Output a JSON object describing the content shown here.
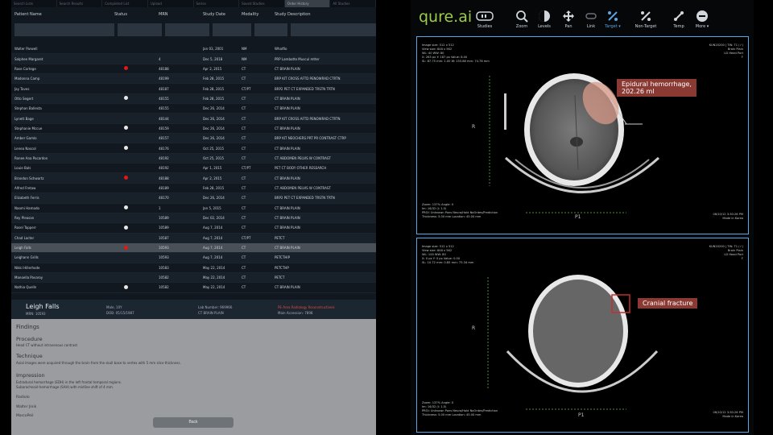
{
  "worklist": {
    "top_tabs": [
      "Search Lists",
      "Search Results",
      "Completed List",
      "Upload",
      "Series",
      "Saved Studies",
      "Order History",
      "All Studies"
    ],
    "active_tab": 6,
    "columns": [
      "Patient Name",
      "Status",
      "MRN",
      "Study Date",
      "Modality",
      "Study Description"
    ],
    "rows": [
      {
        "name": "Walter Parwell",
        "status": "",
        "mrn": "",
        "date": "Jan 03, 2001",
        "mod": "NM",
        "desc": "Whatfio"
      },
      {
        "name": "Salphee Margaret",
        "status": "",
        "mrn": "4",
        "date": "Dec 5, 2018",
        "mod": "NM",
        "desc": "PRP Lambotte Muscul mtter"
      },
      {
        "name": "Rose Cortege",
        "status": "red",
        "mrn": "48188",
        "date": "Apr 2, 2015",
        "mod": "CT",
        "desc": "CT BRAIN PLAIN"
      },
      {
        "name": "Madonna Camp",
        "status": "",
        "mrn": "48199",
        "date": "Feb 28, 2015",
        "mod": "CT",
        "desc": "BRP KIT CROSS AFTD PENOWRAD CTRTN"
      },
      {
        "name": "Jay Taves",
        "status": "",
        "mrn": "48187",
        "date": "Feb 28, 2015",
        "mod": "CT/PT",
        "desc": "BRP2 PET CT EXPANDED TRSTN TRTN"
      },
      {
        "name": "Otto Segert",
        "status": "white",
        "mrn": "48155",
        "date": "Feb 28, 2015",
        "mod": "CT",
        "desc": "CT BRAIN PLAIN"
      },
      {
        "name": "Stephan Ballesta",
        "status": "",
        "mrn": "48155",
        "date": "Dec 26, 2014",
        "mod": "CT",
        "desc": "CT BRAIN PLAIN"
      },
      {
        "name": "Lynett Bage",
        "status": "",
        "mrn": "48144",
        "date": "Dec 26, 2014",
        "mod": "CT",
        "desc": "BRP KIT CROSS AFTD PENOWRAD CTRTN"
      },
      {
        "name": "Stephanie Mccue",
        "status": "white",
        "mrn": "48159",
        "date": "Dec 26, 2014",
        "mod": "CT",
        "desc": "CT BRAIN PLAIN"
      },
      {
        "name": "Amber Gamlo",
        "status": "",
        "mrn": "48157",
        "date": "Dec 26, 2014",
        "mod": "CT",
        "desc": "BRP KIT NEOCHERS PRT PR CONTRAST CTRP"
      },
      {
        "name": "Lenea Nascol",
        "status": "white",
        "mrn": "48176",
        "date": "Oct 25, 2015",
        "mod": "CT",
        "desc": "CT BRAIN PLAIN"
      },
      {
        "name": "Ronee Ana Pocardon",
        "status": "",
        "mrn": "48192",
        "date": "Oct 25, 2015",
        "mod": "CT",
        "desc": "CT ABDOMEN PELVIS W CONTRAST"
      },
      {
        "name": "Louie Bals",
        "status": "",
        "mrn": "48192",
        "date": "Apr 1, 2015",
        "mod": "CT/PT",
        "desc": "PET CT BODY OTHER RESEARCH"
      },
      {
        "name": "Brandon Schwartz",
        "status": "red",
        "mrn": "48188",
        "date": "Apr 2, 2015",
        "mod": "CT",
        "desc": "CT BRAIN PLAIN"
      },
      {
        "name": "Alfred Fretaw",
        "status": "",
        "mrn": "48189",
        "date": "Feb 28, 2015",
        "mod": "CT",
        "desc": "CT ABDOMEN PELVIS W CONTRAST"
      },
      {
        "name": "Elizabeth Ferris",
        "status": "",
        "mrn": "48170",
        "date": "Dec 26, 2014",
        "mod": "CT",
        "desc": "BRP2 PET CT EXPANDED TRSTN TRTN"
      },
      {
        "name": "Naomi Hamado",
        "status": "white",
        "mrn": "1",
        "date": "Jan 5, 2015",
        "mod": "CT",
        "desc": "CT BRAIN PLAIN"
      },
      {
        "name": "Rey Pleasan",
        "status": "",
        "mrn": "10589",
        "date": "Dec 02, 2014",
        "mod": "CT",
        "desc": "CT BRAIN PLAIN"
      },
      {
        "name": "Rosel Tapperr",
        "status": "white",
        "mrn": "10589",
        "date": "Aug 7, 2014",
        "mod": "CT",
        "desc": "CT BRAIN PLAIN"
      },
      {
        "name": "Chad Lacter",
        "status": "",
        "mrn": "10587",
        "date": "Aug 7, 2014",
        "mod": "CT/PT",
        "desc": "PETCT"
      },
      {
        "name": "Leigh Falls",
        "status": "red",
        "mrn": "10593",
        "date": "Aug 7, 2014",
        "mod": "CT",
        "desc": "CT BRAIN PLAIN"
      },
      {
        "name": "Leighann Grills",
        "status": "",
        "mrn": "10593",
        "date": "Aug 7, 2014",
        "mod": "CT",
        "desc": "PETCTHIP"
      },
      {
        "name": "Nikki Hillerhode",
        "status": "",
        "mrn": "10583",
        "date": "May 22, 2014",
        "mod": "CT",
        "desc": "PETCTHP"
      },
      {
        "name": "Manoella Pavaroy",
        "status": "",
        "mrn": "10582",
        "date": "May 22, 2014",
        "mod": "CT",
        "desc": "PETCT"
      },
      {
        "name": "Nathia Quelln",
        "status": "white",
        "mrn": "10582",
        "date": "May 22, 2014",
        "mod": "CT",
        "desc": "CT BRAIN PLAIN"
      }
    ],
    "selected_row": 20
  },
  "detail": {
    "name": "Leigh Falls",
    "mrn": "MRN: 10593",
    "sex": "Male, 10Y",
    "dob": "DOB: 05/15/1987",
    "accession": "Lab Number: 969966",
    "study": "CT BRAIN PLAIN",
    "urgent": "PE Area Radiology Reconstructiveis",
    "institution": "Main Accession: 7898"
  },
  "report": {
    "findings": "Findings",
    "procedure_h": "Procedure",
    "procedure": "Head CT without intravenous contrast",
    "technique_h": "Technique",
    "technique": "Axial images were acquired through the brain from the skull base to vertex with 5 mm slice thickness.",
    "impression_h": "Impression",
    "impression1": "Extradural hemorrhage (EDH) in the left frontal temporal regions.",
    "impression2": "Subarachnoid hemorrhage (SAH) with midline shift of 4 mm.",
    "footer1": "Radiolo",
    "footer2": "Walter Jinik",
    "footer3": "MarcoPeil",
    "back_label": "Back"
  },
  "viewer": {
    "logo": "qure.ai",
    "tools": [
      {
        "label": "Studies",
        "icon": "studies-icon",
        "active": false
      },
      {
        "label": "Zoom",
        "icon": "zoom-icon",
        "active": false
      },
      {
        "label": "Levels",
        "icon": "levels-icon",
        "active": false
      },
      {
        "label": "Pan",
        "icon": "pan-icon",
        "active": false
      },
      {
        "label": "Link",
        "icon": "link-icon",
        "active": false
      },
      {
        "label": "Target ▾",
        "icon": "target-icon",
        "active": true
      },
      {
        "label": "Non-Target",
        "icon": "non-target-icon",
        "active": false
      },
      {
        "label": "Temp",
        "icon": "temp-icon",
        "active": false
      },
      {
        "label": "More ▾",
        "icon": "more-icon",
        "active": false
      }
    ],
    "viewport1": {
      "tl": "Image size: 512 x 512\nView size: 848 x 562\nWL: 40 WW: 80\nX: 263 px Y: 187 px Value: 8.00\nSL: 87.75 mm: 1.00 W: 155.88 mm: 74.78 mm",
      "tr": "KUN20200 | TIN: T1 (✓)\nBrain Plain\nLD Head Port\nF",
      "bl": "Zoom: 137% Angle: 0\nIm: 16/32 (I: 1.5)\nPROI: Unknown Pons Neuro/Hold NoOrdes/Prediction\nThickness: 5.00 mm Location: 45.00 mm",
      "br": "06/10/12 3:30:26 PM\nMade In Korea",
      "label": "Epidural hemorrhage,\n202.26 ml",
      "orient_left": "R",
      "orient_bottom": "P1"
    },
    "viewport2": {
      "tl": "Image size: 512 x 512\nView size: 848 x 562\nWL: 100 WW: 80\nX: 0 px Y: 0 px Value: 0.00\nSL: 10.72 mm: 0.85 mm: 75.34 mm",
      "tr": "KUN20200 | TIN: T1 (✓)\nBrain Plain\nLD Head Port\nF",
      "bl": "Zoom: 137% Angle: 0\nIm: 16/32 (I: 1.5)\nPROI: Unknown Pons Neuro/Hold NoOrdes/Prediction\nThickness: 5.00 mm Location: 45.00 mm",
      "br": "06/10/12 3:30:26 PM\nMade In Korea",
      "label": "Cranial fracture",
      "orient_left": "R",
      "orient_bottom": "P1"
    }
  },
  "colors": {
    "accent": "#5aa7e6",
    "logo": "#9ccc4a",
    "alert": "#8a3a33",
    "status_red": "#e01818",
    "status_white": "#e8e8e8",
    "urgent_text": "#e04a3a"
  }
}
